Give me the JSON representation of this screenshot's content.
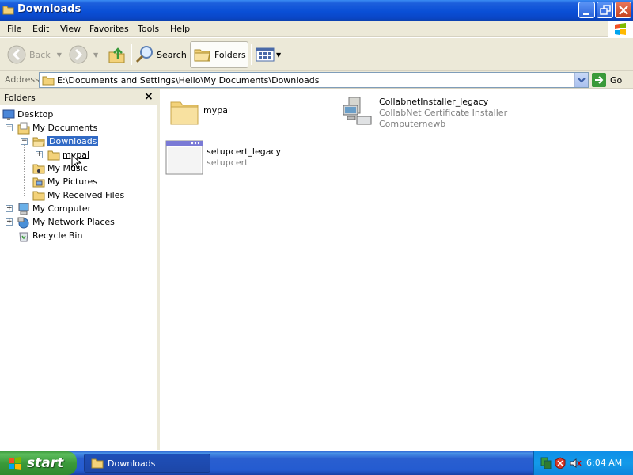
{
  "window": {
    "title": "Downloads"
  },
  "menubar": {
    "items": [
      "File",
      "Edit",
      "View",
      "Favorites",
      "Tools",
      "Help"
    ]
  },
  "toolbar": {
    "back_label": "Back",
    "search_label": "Search",
    "folders_label": "Folders"
  },
  "address": {
    "label": "Address",
    "value": "E:\\Documents and Settings\\Hello\\My Documents\\Downloads",
    "go_label": "Go"
  },
  "folders_pane": {
    "title": "Folders",
    "close_glyph": "×",
    "tree": [
      {
        "label": "Desktop",
        "icon": "desktop-icon"
      },
      {
        "label": "My Documents",
        "icon": "my-documents-icon",
        "expander": "−"
      },
      {
        "label": "Downloads",
        "icon": "folder-open-icon",
        "expander": "−",
        "selected": true
      },
      {
        "label": "mypal",
        "icon": "folder-icon",
        "expander": "+"
      },
      {
        "label": "My Music",
        "icon": "music-folder-icon"
      },
      {
        "label": "My Pictures",
        "icon": "pictures-folder-icon"
      },
      {
        "label": "My Received Files",
        "icon": "folder-icon"
      },
      {
        "label": "My Computer",
        "icon": "computer-icon",
        "expander": "+"
      },
      {
        "label": "My Network Places",
        "icon": "network-icon",
        "expander": "+"
      },
      {
        "label": "Recycle Bin",
        "icon": "recycle-bin-icon"
      }
    ]
  },
  "content": {
    "items": [
      {
        "name": "mypal",
        "sub1": "",
        "sub2": "",
        "icon": "folder-icon"
      },
      {
        "name": "CollabnetInstaller_legacy",
        "sub1": "CollabNet Certificate Installer",
        "sub2": "Computernewb",
        "icon": "installer-icon"
      },
      {
        "name": "setupcert_legacy",
        "sub1": "setupcert",
        "sub2": "",
        "icon": "application-window-icon"
      }
    ]
  },
  "taskbar": {
    "start_label": "start",
    "task_label": "Downloads",
    "clock": "6:04 AM"
  },
  "colors": {
    "title_blue": "#0a4fd6",
    "selection": "#316ac5",
    "start_green": "#3a9a3a",
    "tray_blue": "#139ae9"
  }
}
